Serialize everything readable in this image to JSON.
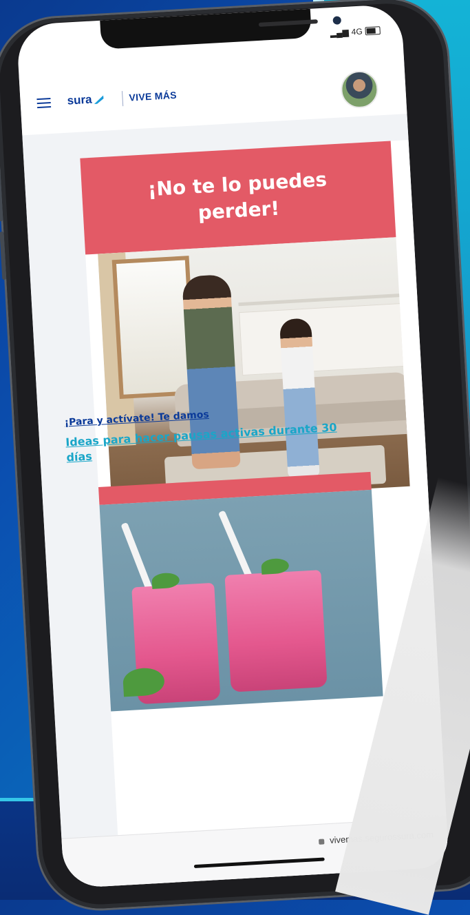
{
  "status_bar": {
    "signal": "4G"
  },
  "header": {
    "logo_text": "sura",
    "brand_text": "VIVE MÁS",
    "menu_icon": "hamburger-icon",
    "avatar_icon": "avatar"
  },
  "banner": {
    "title": "¡No te lo puedes perder!"
  },
  "article": {
    "intro": "¡Para y actívate! Te damos",
    "link": "Ideas para hacer pausas activas durante 30 días"
  },
  "browser": {
    "url": "vivemas.segurossura.com"
  },
  "colors": {
    "accent_red": "#e35a66",
    "brand_blue": "#0b3a99",
    "link_cyan": "#1aa6c8"
  }
}
